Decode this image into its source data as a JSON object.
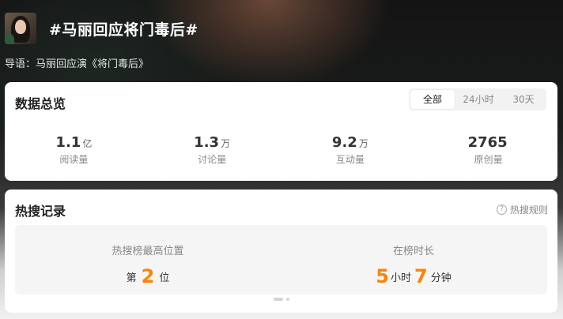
{
  "topic": {
    "title": "#马丽回应将门毒后#",
    "intro": "导语：马丽回应演《将门毒后》"
  },
  "overview": {
    "title": "数据总览",
    "tabs": [
      "全部",
      "24小时",
      "30天"
    ],
    "active_tab": "全部",
    "stats": [
      {
        "value": "1.1",
        "unit": "亿",
        "label": "阅读量"
      },
      {
        "value": "1.3",
        "unit": "万",
        "label": "讨论量"
      },
      {
        "value": "9.2",
        "unit": "万",
        "label": "互动量"
      },
      {
        "value": "2765",
        "unit": "",
        "label": "原创量"
      }
    ]
  },
  "hot_search": {
    "title": "热搜记录",
    "rules_label": "热搜规则",
    "rules_icon": "question-circle-icon",
    "highest_position": {
      "label": "热搜榜最高位置",
      "prefix": "第",
      "value": "2",
      "suffix": "位"
    },
    "duration": {
      "label": "在榜时长",
      "hours": "5",
      "hours_unit": "小时",
      "minutes": "7",
      "minutes_unit": "分钟"
    }
  },
  "colors": {
    "accent": "#ff8200"
  }
}
